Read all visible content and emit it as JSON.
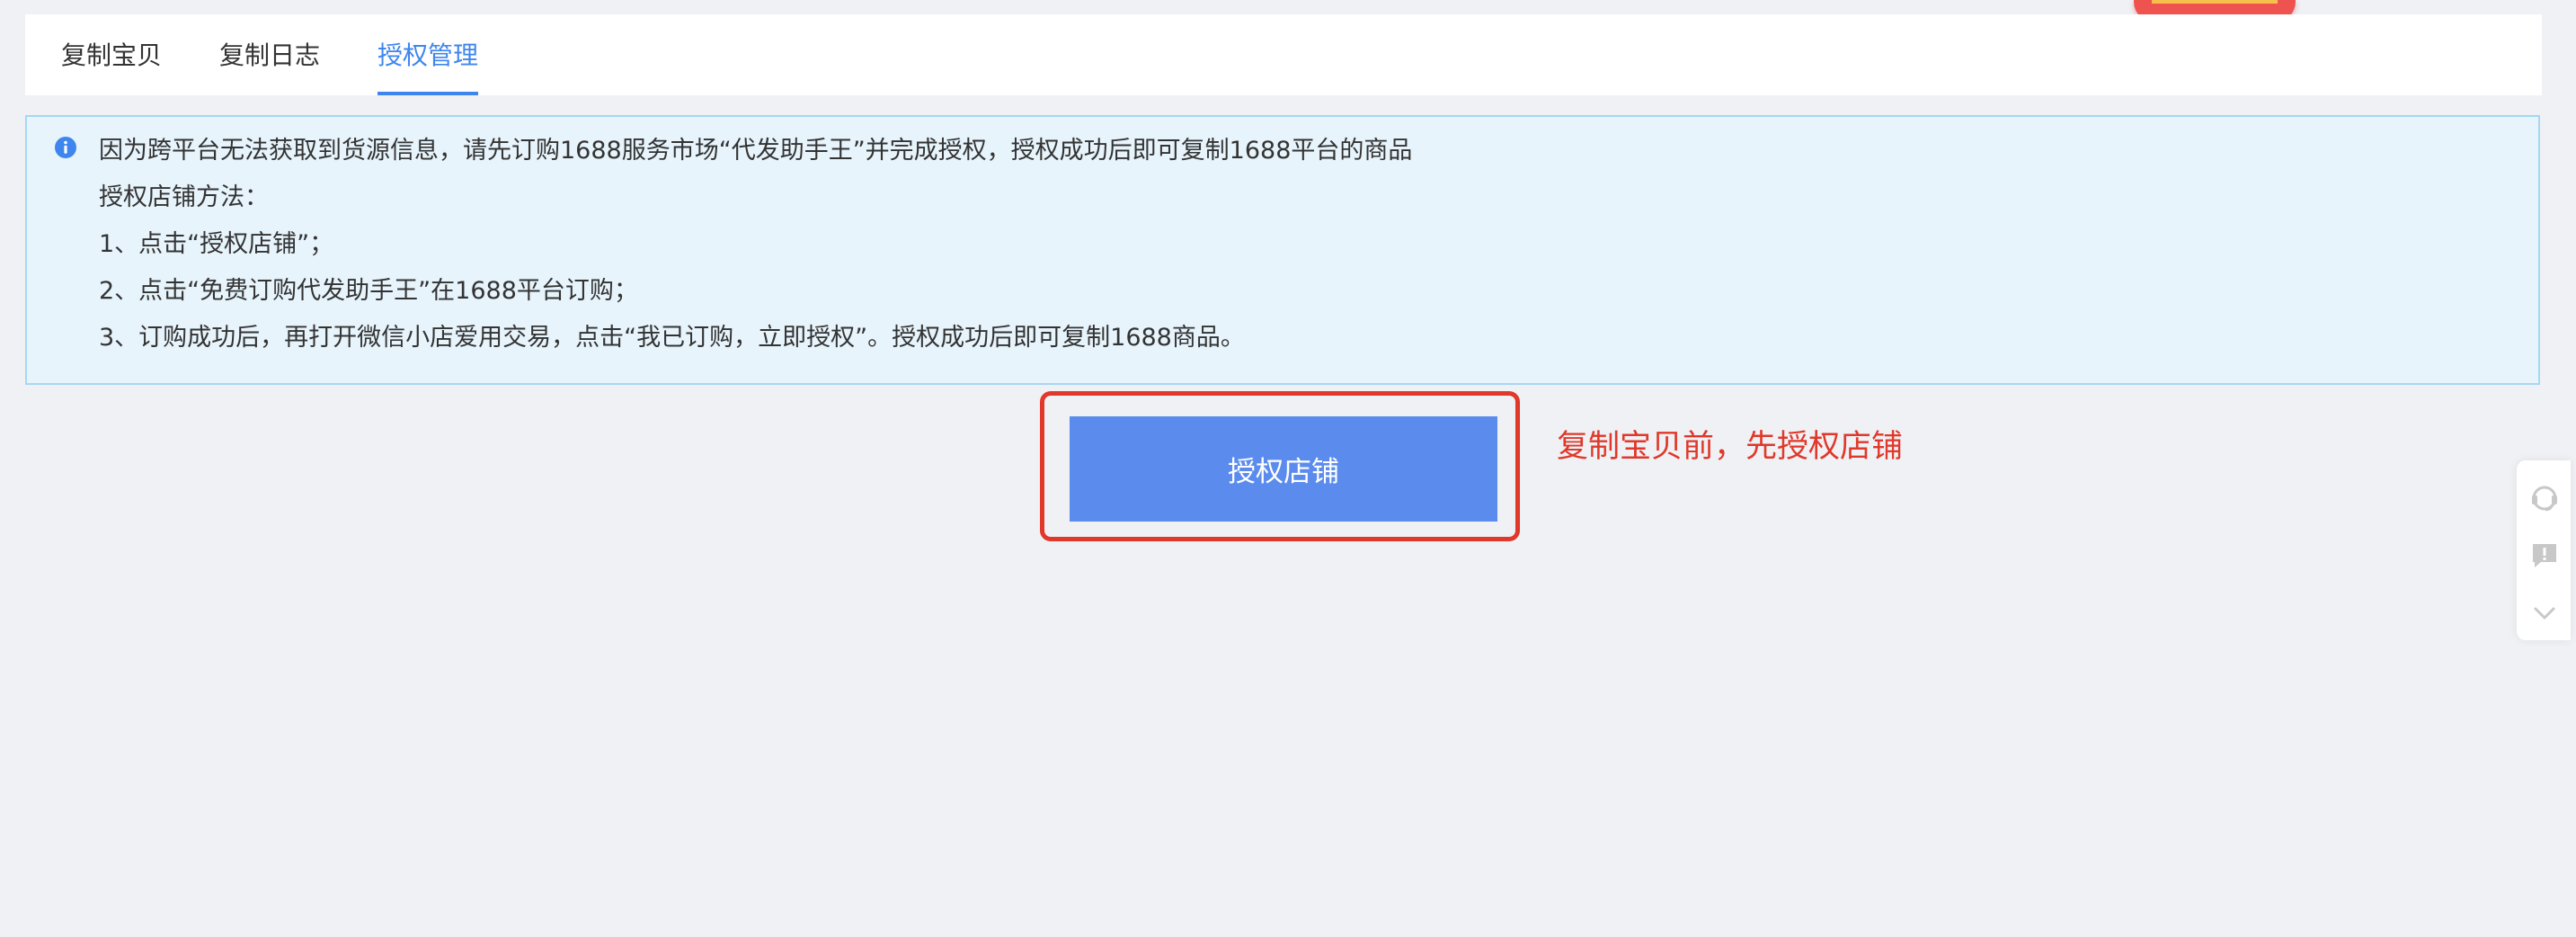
{
  "tabs": [
    {
      "label": "复制宝贝",
      "active": false
    },
    {
      "label": "复制日志",
      "active": false
    },
    {
      "label": "授权管理",
      "active": true
    }
  ],
  "notice": {
    "icon": "info-icon",
    "lines": [
      "因为跨平台无法获取到货源信息，请先订购1688服务市场“代发助手王”并完成授权，授权成功后即可复制1688平台的商品",
      "授权店铺方法：",
      "1、点击“授权店铺”；",
      "2、点击“免费订购代发助手王”在1688平台订购；",
      "3、订购成功后，再打开微信小店爱用交易，点击“我已订购，立即授权”。授权成功后即可复制1688商品。"
    ]
  },
  "action": {
    "button_label": "授权店铺",
    "annotation": "复制宝贝前，先授权店铺"
  },
  "side_toolbar": {
    "icons": [
      "headset-icon",
      "feedback-icon",
      "chevron-down-icon"
    ]
  },
  "colors": {
    "accent": "#3e86ee",
    "button": "#5b8ced",
    "annotation_red": "#e0382a",
    "notice_bg": "#e7f4fc",
    "notice_border": "#a6d7f3"
  }
}
